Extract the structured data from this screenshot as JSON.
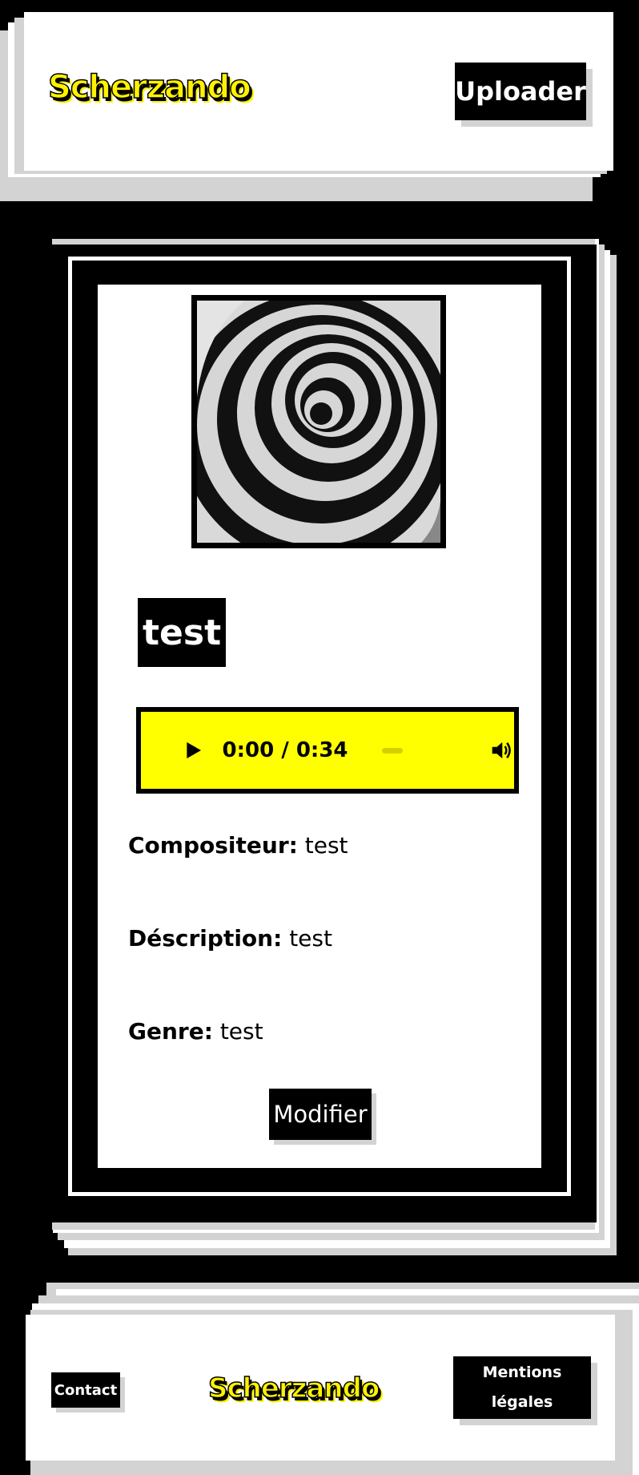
{
  "header": {
    "logo_text": "Scherzando",
    "upload_button": "Uploader"
  },
  "track": {
    "title": "test",
    "player": {
      "current_time": "0:00",
      "separator": " / ",
      "duration": "0:34",
      "play_icon": "play-icon",
      "volume_icon": "volume-icon"
    },
    "fields": [
      {
        "label": "Compositeur:",
        "value": "test"
      },
      {
        "label": "Déscription:",
        "value": "test"
      },
      {
        "label": "Genre:",
        "value": "test"
      }
    ],
    "edit_button": "Modifier",
    "cover_image": "spiral-cover-image"
  },
  "footer": {
    "contact_button": "Contact",
    "logo_text": "Scherzando",
    "legal_button_line1": "Mentions",
    "legal_button_line2": "légales"
  },
  "colors": {
    "accent": "#ffff00",
    "background": "#000000",
    "paper": "#ffffff",
    "shadow": "#d3d3d3"
  }
}
